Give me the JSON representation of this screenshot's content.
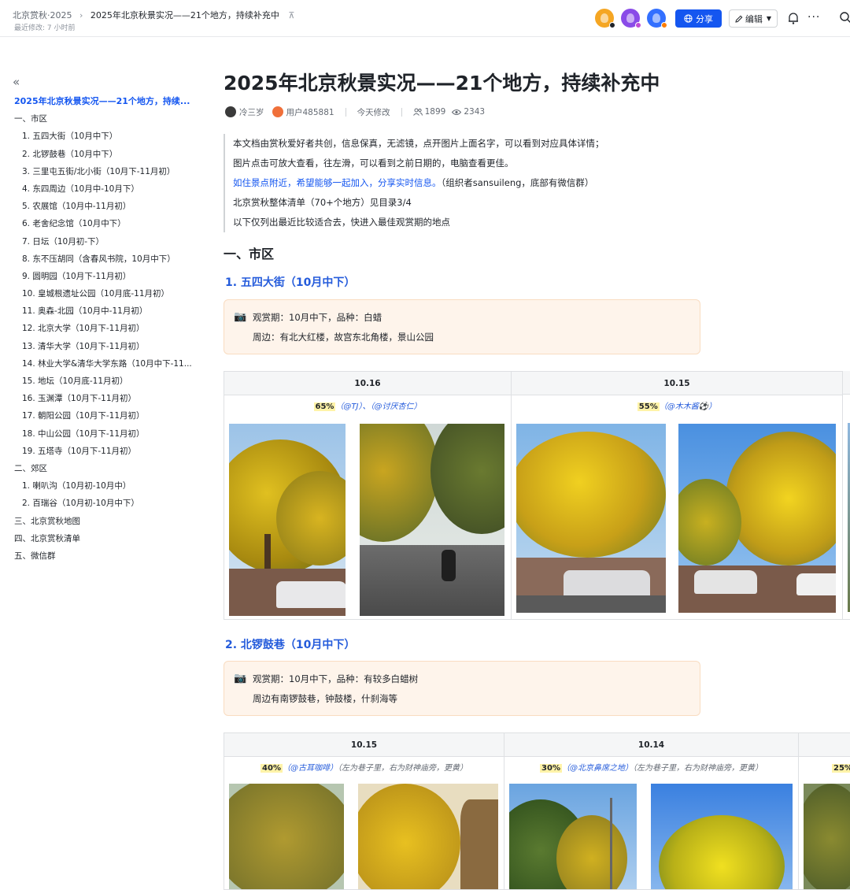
{
  "topbar": {
    "breadcrumb_parent": "北京赏秋·2025",
    "breadcrumb_current": "2025年北京秋景实况——21个地方，持续补充中",
    "last_modified": "最近修改: 7 小时前",
    "share_label": "分享",
    "edit_label": "编辑",
    "avatar_colors": [
      "#f5a623",
      "#8a4be8",
      "#3370ff"
    ]
  },
  "toc": {
    "items": [
      {
        "label": "2025年北京秋景实况——21个地方，持续...",
        "level": 0
      },
      {
        "label": "一、市区",
        "level": 1
      },
      {
        "label": "1. 五四大街（10月中下）",
        "level": 2
      },
      {
        "label": "2. 北锣鼓巷（10月中下）",
        "level": 2
      },
      {
        "label": "3. 三里屯五街/北小街（10月下-11月初）",
        "level": 2
      },
      {
        "label": "4. 东四周边（10月中-10月下）",
        "level": 2
      },
      {
        "label": "5. 农展馆（10月中-11月初）",
        "level": 2
      },
      {
        "label": "6. 老舍纪念馆（10月中下）",
        "level": 2
      },
      {
        "label": "7. 日坛（10月初-下）",
        "level": 2
      },
      {
        "label": "8. 东不压胡同（含春风书院，10月中下）",
        "level": 2
      },
      {
        "label": "9. 圆明园（10月下-11月初）",
        "level": 2
      },
      {
        "label": "10. 皇城根遗址公园（10月底-11月初）",
        "level": 2
      },
      {
        "label": "11. 奥森-北园（10月中-11月初）",
        "level": 2
      },
      {
        "label": "12. 北京大学（10月下-11月初）",
        "level": 2
      },
      {
        "label": "13. 清华大学（10月下-11月初）",
        "level": 2
      },
      {
        "label": "14. 林业大学&清华大学东路（10月中下-11...",
        "level": 2
      },
      {
        "label": "15. 地坛（10月底-11月初）",
        "level": 2
      },
      {
        "label": "16. 玉渊潭（10月下-11月初）",
        "level": 2
      },
      {
        "label": "17. 朝阳公园（10月下-11月初）",
        "level": 2
      },
      {
        "label": "18. 中山公园（10月下-11月初）",
        "level": 2
      },
      {
        "label": "19. 五塔寺（10月下-11月初）",
        "level": 2
      },
      {
        "label": "二、郊区",
        "level": 1
      },
      {
        "label": "1. 喇叭沟（10月初-10月中）",
        "level": 2
      },
      {
        "label": "2. 百瑞谷（10月初-10月中下）",
        "level": 2
      },
      {
        "label": "三、北京赏秋地图",
        "level": 1
      },
      {
        "label": "四、北京赏秋清单",
        "level": 1
      },
      {
        "label": "五、微信群",
        "level": 1
      }
    ]
  },
  "doc": {
    "title": "2025年北京秋景实况——21个地方，持续补充中",
    "author1": "冷三岁",
    "author2": "用户485881",
    "modified": "今天修改",
    "collaborators": "1899",
    "views": "2343",
    "intro": {
      "line1": "本文档由赏秋爱好者共创，信息保真，无滤镜，点开图片上面名字，可以看到对应具体详情；",
      "line2": "图片点击可放大查看，往左滑，可以看到之前日期的，电脑查看更佳。",
      "line3_blue": "如住景点附近，希望能够一起加入，分享实时信息。",
      "line3_rest": "（组织者sansuileng，底部有微信群）",
      "line4": "北京赏秋整体清单（70+个地方）见目录3/4",
      "line5": "以下仅列出最近比较适合去，快进入最佳观赏期的地点"
    },
    "section1": "一、市区",
    "spot1": {
      "heading": "1. 五四大街（10月中下）",
      "callout_line1": "观赏期：10月中下，品种：白蜡",
      "callout_line2": "周边：有北大红楼，故宫东北角楼，景山公园",
      "columns": [
        {
          "date": "10.16",
          "pct": "65%",
          "who": "（@TJ）、（@讨厌杏仁）",
          "note": ""
        },
        {
          "date": "10.15",
          "pct": "55%",
          "who": "（@木木酱⚽）",
          "note": ""
        }
      ]
    },
    "spot2": {
      "heading": "2. 北锣鼓巷（10月中下）",
      "callout_line1": "观赏期：10月中下，品种：有较多白蜡树",
      "callout_line2": "周边有南锣鼓巷，钟鼓楼，什刹海等",
      "columns": [
        {
          "date": "10.15",
          "pct": "40%",
          "who": "（@古耳咖啡）",
          "note": "（左为巷子里，右为财神庙旁，更黄）"
        },
        {
          "date": "10.14",
          "pct": "30%",
          "who": "（@北京鼻席之地）",
          "note": "（左为巷子里，右为财神庙旁，更黄）"
        },
        {
          "date": "",
          "pct": "25%",
          "who": "",
          "note": ""
        }
      ]
    }
  }
}
